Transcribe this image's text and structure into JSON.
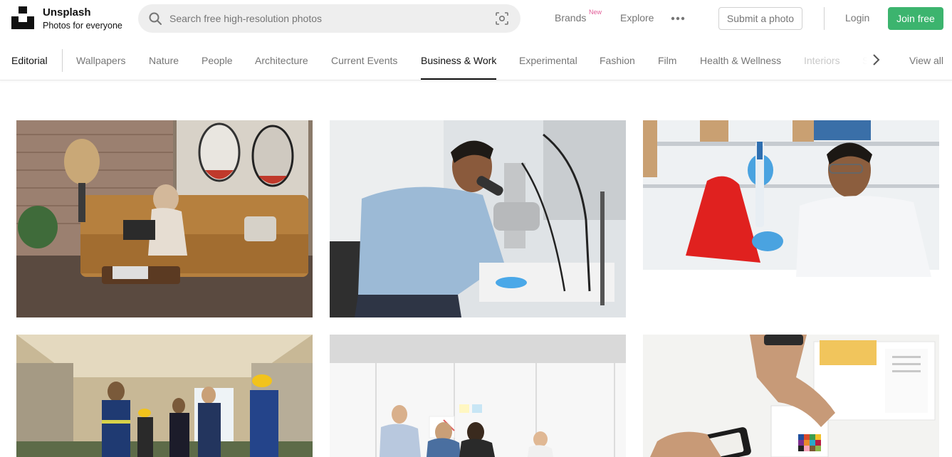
{
  "brand": {
    "name": "Unsplash",
    "tagline": "Photos for everyone"
  },
  "search": {
    "placeholder": "Search free high-resolution photos"
  },
  "nav": {
    "brands": "Brands",
    "brands_badge": "New",
    "explore": "Explore",
    "submit": "Submit a photo",
    "login": "Login",
    "join": "Join free"
  },
  "topics": {
    "editorial": "Editorial",
    "items": [
      "Wallpapers",
      "Nature",
      "People",
      "Architecture",
      "Current Events",
      "Business & Work",
      "Experimental",
      "Fashion",
      "Film",
      "Health & Wellness",
      "Interiors",
      "S"
    ],
    "active": "Business & Work",
    "view_all": "View all"
  },
  "colors": {
    "accent_green": "#3cb46e",
    "badge_pink": "#e25c97",
    "text_muted": "#767676"
  },
  "photos": [
    "woman-with-laptop-on-sofa",
    "man-using-microscope",
    "scientist-with-pipette",
    "workers-in-hard-hats",
    "team-at-whiteboard",
    "hands-with-phone-and-color-swatches"
  ]
}
